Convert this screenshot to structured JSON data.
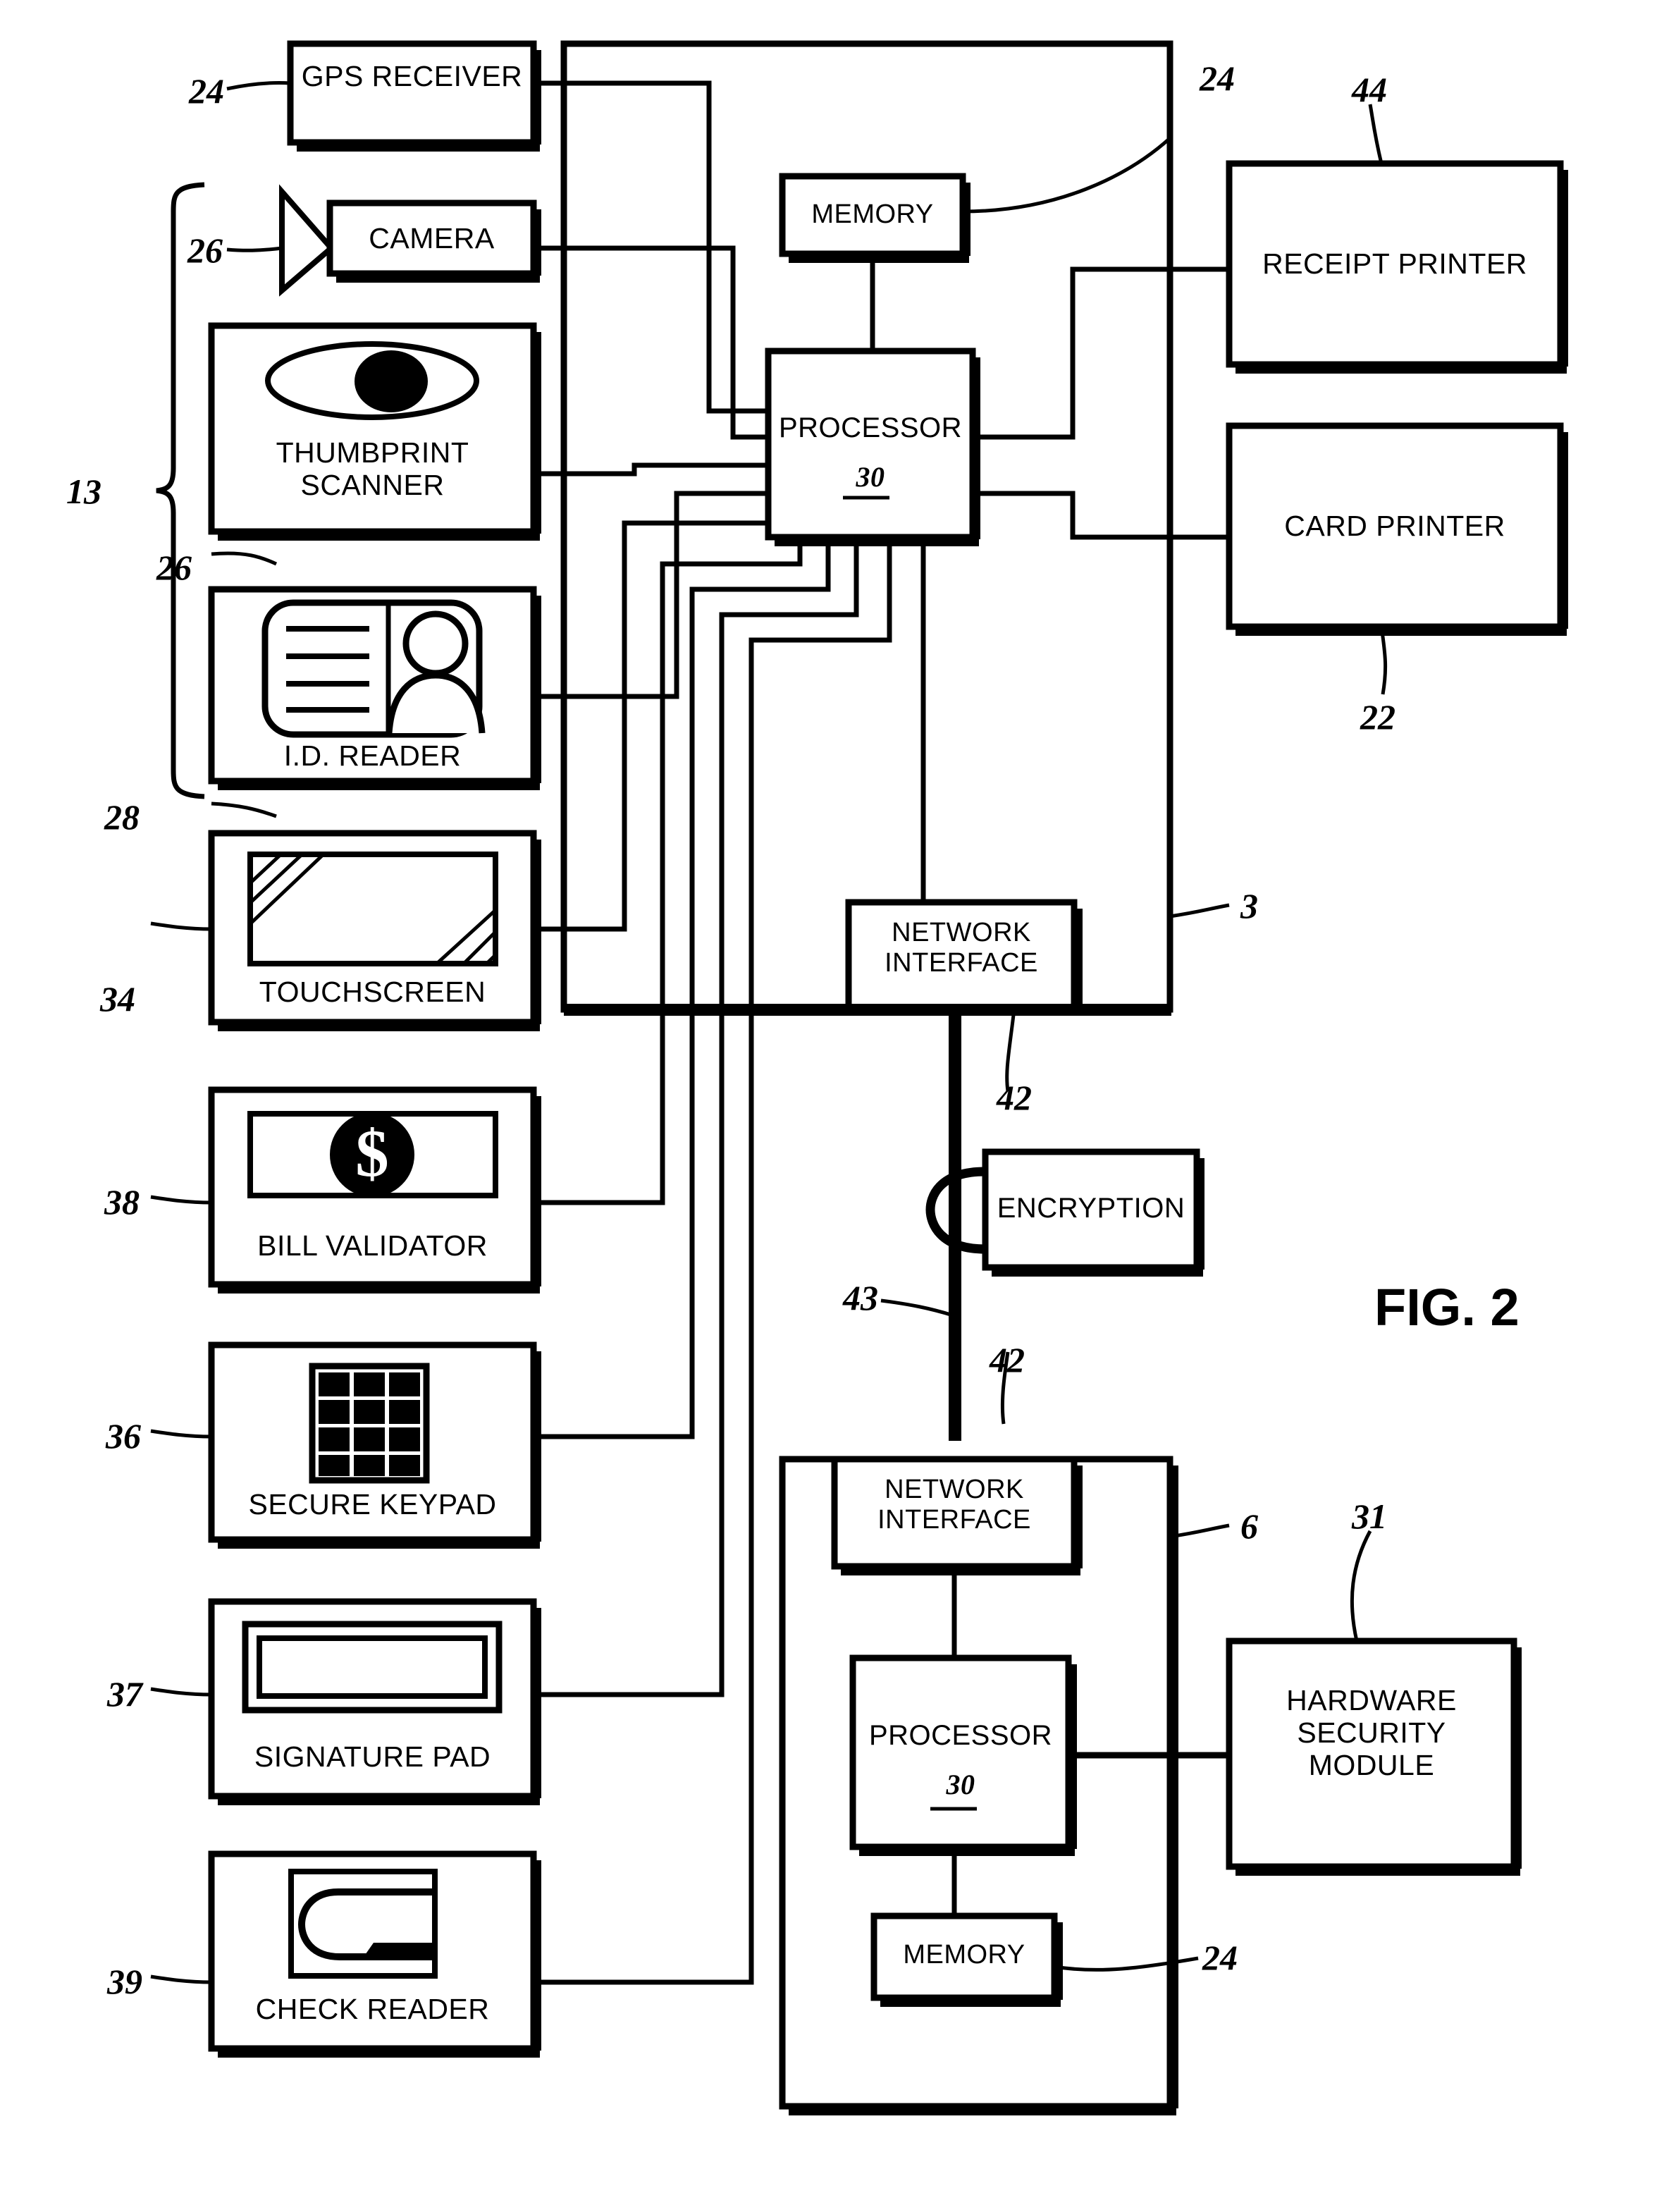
{
  "figure": {
    "label": "FIG. 2"
  },
  "kiosk": {
    "ref": "3",
    "devices": [
      {
        "name": "GPS RECEIVER",
        "ref": "24",
        "icon": "none"
      },
      {
        "name": "CAMERA",
        "ref": "26",
        "icon": "camera-lens-icon"
      },
      {
        "name": "THUMBPRINT\nSCANNER",
        "ref": "26",
        "icon": "eye-scan-icon"
      },
      {
        "name": "I.D. READER",
        "ref": "28",
        "icon": "id-card-icon"
      },
      {
        "name": "TOUCHSCREEN",
        "ref": "34",
        "icon": "screen-icon"
      },
      {
        "name": "BILL VALIDATOR",
        "ref": "38",
        "icon": "dollar-bill-icon"
      },
      {
        "name": "SECURE KEYPAD",
        "ref": "36",
        "icon": "keypad-grid-icon"
      },
      {
        "name": "SIGNATURE PAD",
        "ref": "37",
        "icon": "signature-strip-icon"
      },
      {
        "name": "CHECK READER",
        "ref": "39",
        "icon": "check-slot-icon"
      }
    ],
    "group_brace_ref": "13",
    "memory": {
      "name": "MEMORY",
      "ref": "24"
    },
    "processor": {
      "name": "PROCESSOR",
      "ref": "30"
    },
    "network_interface": {
      "name": "NETWORK\nINTERFACE",
      "ref": "42"
    },
    "receipt_printer": {
      "name": "RECEIPT PRINTER",
      "ref": "44"
    },
    "card_printer": {
      "name": "CARD PRINTER",
      "ref": "22"
    }
  },
  "link": {
    "encryption": {
      "name": "ENCRYPTION"
    },
    "bus_ref": "43",
    "bottom_ni_ref": "42"
  },
  "server": {
    "ref": "6",
    "network_interface": {
      "name": "NETWORK\nINTERFACE"
    },
    "processor": {
      "name": "PROCESSOR",
      "ref": "30"
    },
    "memory": {
      "name": "MEMORY",
      "ref": "24"
    },
    "hsm": {
      "name": "HARDWARE\nSECURITY\nMODULE",
      "ref": "31"
    }
  },
  "colors": {
    "ink": "#000000",
    "paper": "#ffffff"
  }
}
